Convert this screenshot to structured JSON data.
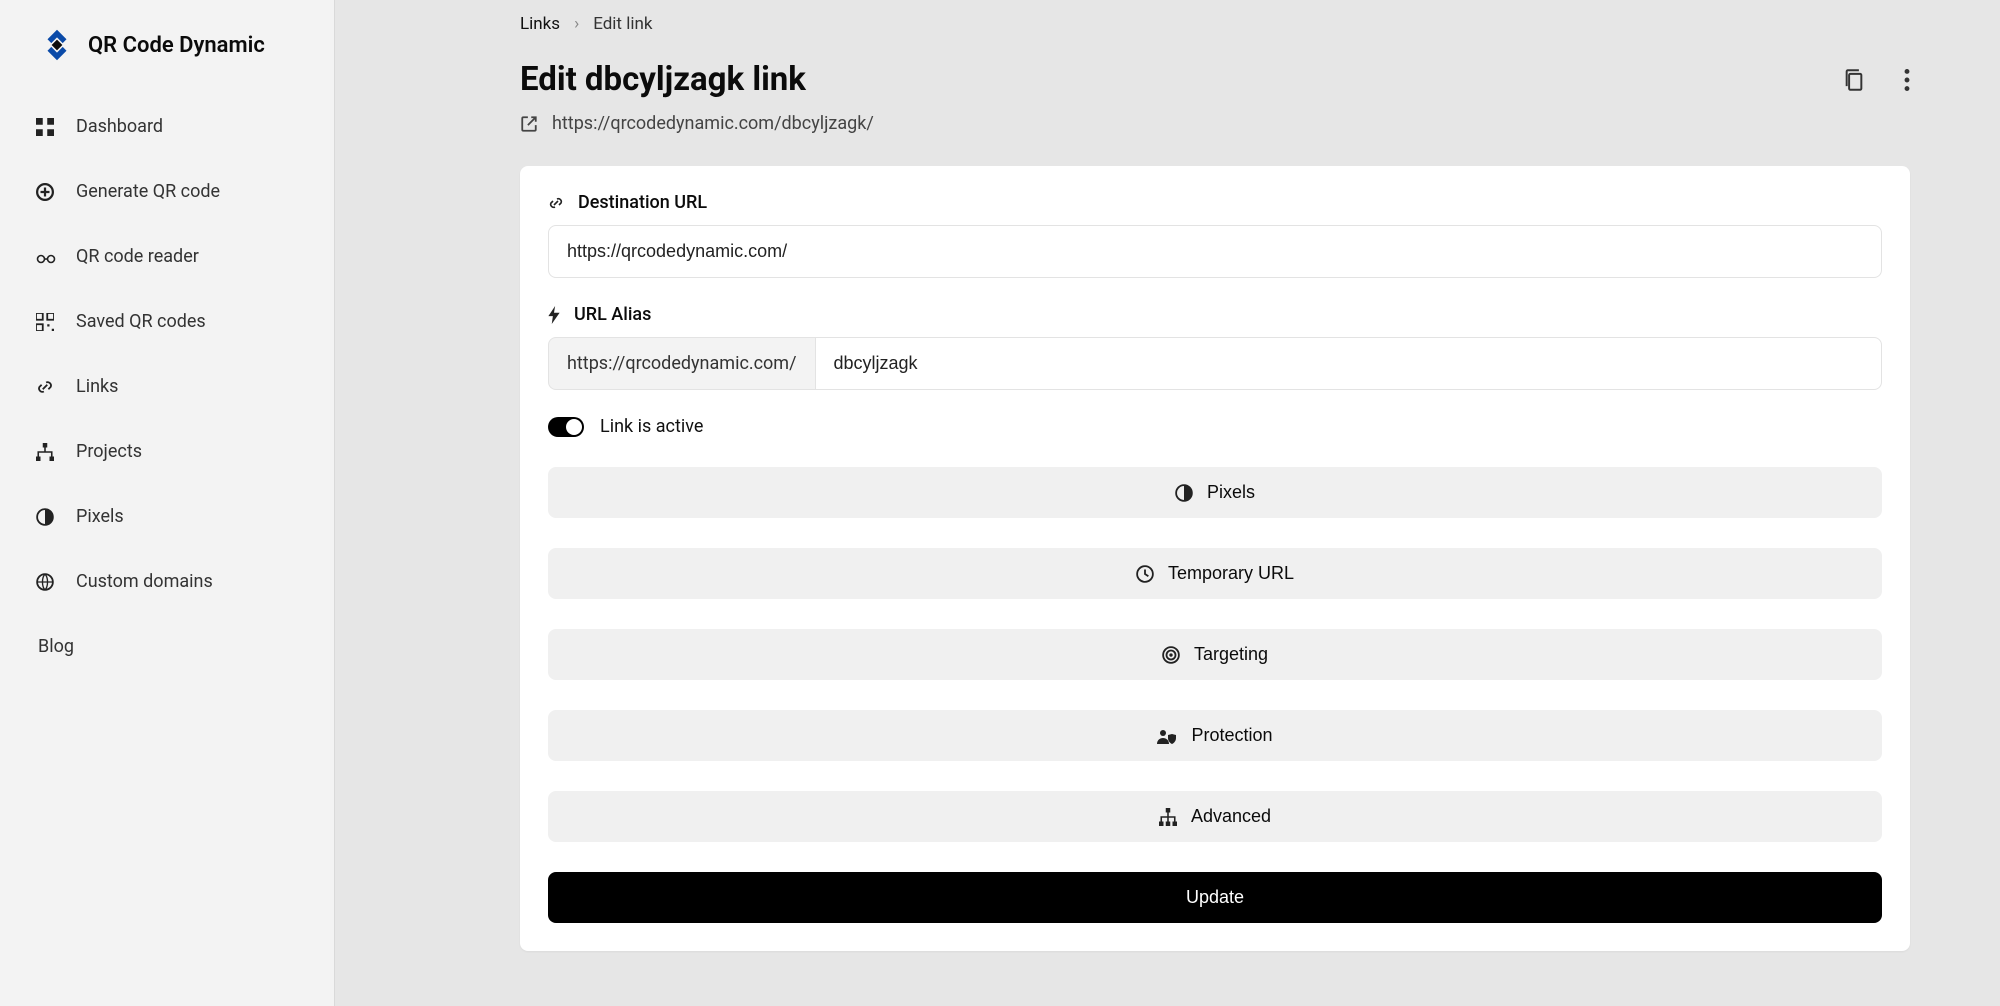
{
  "brand": {
    "name": "QR Code Dynamic"
  },
  "sidebar": {
    "items": [
      {
        "label": "Dashboard",
        "icon": "grid-icon"
      },
      {
        "label": "Generate QR code",
        "icon": "plus-circle-icon"
      },
      {
        "label": "QR code reader",
        "icon": "glasses-icon"
      },
      {
        "label": "Saved QR codes",
        "icon": "qr-icon"
      },
      {
        "label": "Links",
        "icon": "link-icon"
      },
      {
        "label": "Projects",
        "icon": "diagram-icon"
      },
      {
        "label": "Pixels",
        "icon": "adjust-icon"
      },
      {
        "label": "Custom domains",
        "icon": "globe-icon"
      },
      {
        "label": "Blog",
        "icon": ""
      }
    ]
  },
  "breadcrumb": {
    "parent": "Links",
    "current": "Edit link"
  },
  "header": {
    "title": "Edit dbcyljzagk link",
    "url": "https://qrcodedynamic.com/dbcyljzagk/"
  },
  "form": {
    "destination": {
      "label": "Destination URL",
      "value": "https://qrcodedynamic.com/"
    },
    "alias": {
      "label": "URL Alias",
      "prefix": "https://qrcodedynamic.com/",
      "value": "dbcyljzagk"
    },
    "toggle": {
      "label": "Link is active",
      "on": true
    },
    "sections": [
      {
        "label": "Pixels",
        "icon": "adjust-icon"
      },
      {
        "label": "Temporary URL",
        "icon": "clock-icon"
      },
      {
        "label": "Targeting",
        "icon": "target-icon"
      },
      {
        "label": "Protection",
        "icon": "user-shield-icon"
      },
      {
        "label": "Advanced",
        "icon": "sitemap-icon"
      }
    ],
    "submit": "Update"
  }
}
